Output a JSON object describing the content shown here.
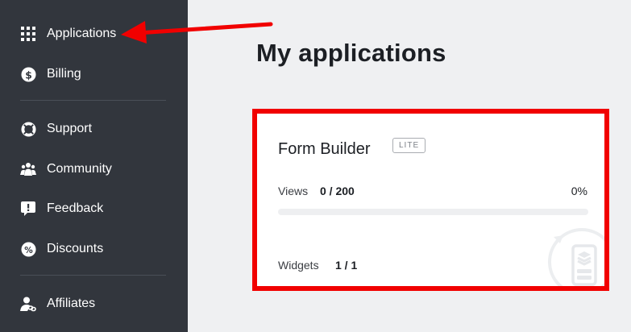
{
  "sidebar": {
    "items": [
      {
        "label": "Applications",
        "icon": "grid-icon"
      },
      {
        "label": "Billing",
        "icon": "dollar-icon"
      },
      {
        "label": "Support",
        "icon": "lifebuoy-icon"
      },
      {
        "label": "Community",
        "icon": "people-icon"
      },
      {
        "label": "Feedback",
        "icon": "chat-exclamation-icon"
      },
      {
        "label": "Discounts",
        "icon": "percent-icon"
      },
      {
        "label": "Affiliates",
        "icon": "user-link-icon"
      }
    ]
  },
  "main": {
    "title": "My applications",
    "card": {
      "app_name": "Form Builder",
      "badge": "LITE",
      "views_label": "Views",
      "views_value": "0 / 200",
      "views_percent": "0%",
      "views_progress": 0,
      "widgets_label": "Widgets",
      "widgets_value": "1 / 1"
    }
  },
  "colors": {
    "sidebar_bg": "#32363d",
    "highlight_red": "#f10000",
    "page_bg": "#eff0f2"
  }
}
